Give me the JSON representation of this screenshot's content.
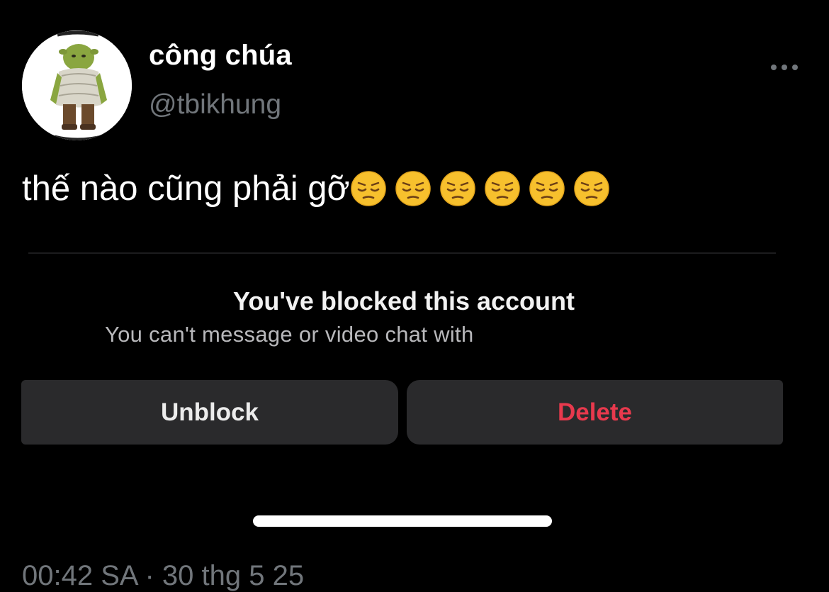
{
  "tweet": {
    "display_name": "công chúa",
    "handle": "@tbikhung",
    "avatar_icon": "shrek-avatar-icon",
    "more_icon": "more-horizontal-icon",
    "text": "thế nào cũng phải gỡ",
    "emoji": [
      "pensive-face-icon",
      "pensive-face-icon",
      "pensive-face-icon",
      "pensive-face-icon",
      "pensive-face-icon",
      "pensive-face-icon"
    ],
    "timestamp": "00:42 SA · 30 thg 5 25"
  },
  "media": {
    "title": "You've blocked this account",
    "subtitle": "You can't message or video chat with",
    "unblock_label": "Unblock",
    "delete_label": "Delete"
  },
  "colors": {
    "background": "#000000",
    "muted_text": "#71767b",
    "delete_red": "#e8394d",
    "button_bg": "#2a2a2c"
  }
}
